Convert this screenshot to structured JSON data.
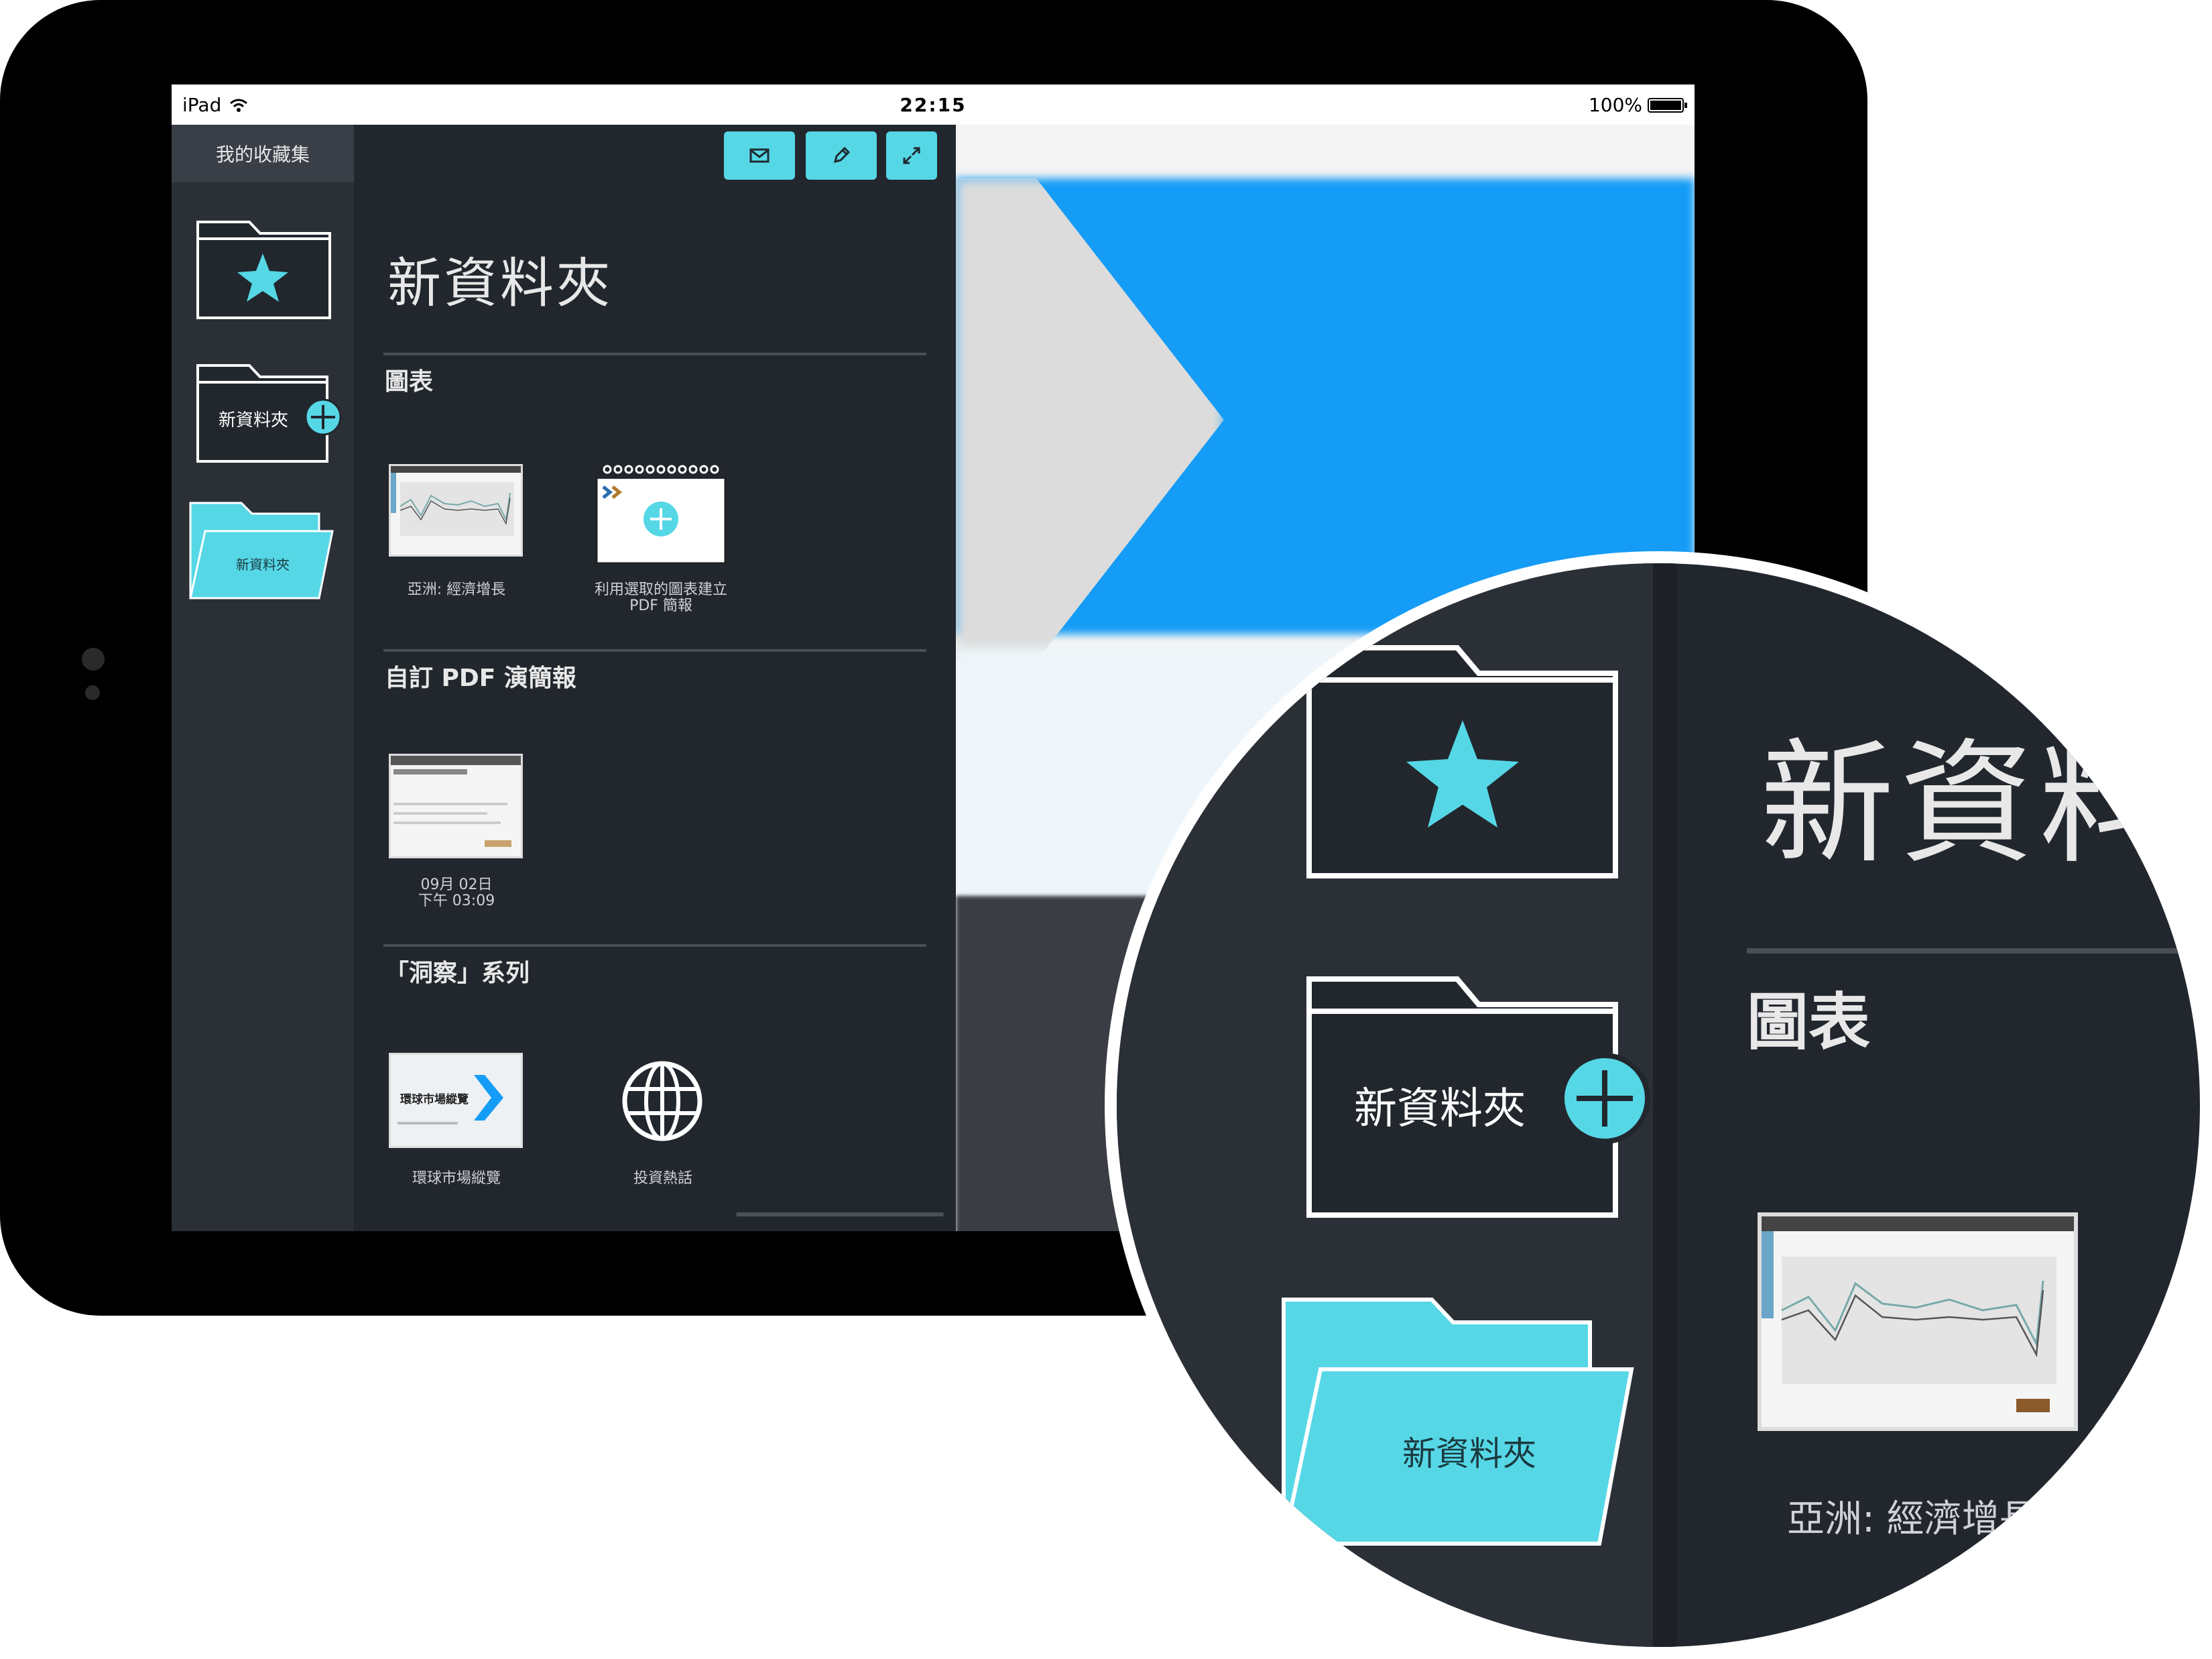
{
  "status_bar": {
    "device": "iPad",
    "time": "22:15",
    "battery": "100%"
  },
  "sidebar": {
    "header": "我的收藏集",
    "new_folder_label": "新資料夾",
    "active_folder_label": "新資料夾"
  },
  "toolbar": {
    "buttons": [
      "mail",
      "edit",
      "expand"
    ]
  },
  "panel": {
    "title": "新資料夾",
    "sections": [
      {
        "title": "圖表",
        "items": [
          {
            "caption": "亞洲: 經濟增長"
          },
          {
            "caption_line1": "利用選取的圖表建立",
            "caption_line2": "PDF 簡報"
          }
        ]
      },
      {
        "title": "自訂 PDF 演簡報",
        "items": [
          {
            "caption_line1": "09月 02日",
            "caption_line2": "下午 03:09"
          }
        ]
      },
      {
        "title": "「洞察」系列",
        "items": [
          {
            "caption": "環球市場縱覽",
            "thumb_text": "環球市場縱覽"
          },
          {
            "caption": "投資熱話"
          }
        ]
      }
    ]
  },
  "zoom": {
    "title": "新資料",
    "section": "圖表",
    "caption": "亞洲: 經濟增長",
    "new_folder_label": "新資料夾",
    "active_folder_label": "新資料夾"
  },
  "colors": {
    "accent": "#56d7e6",
    "panel": "#22272e",
    "rail": "#2b3037",
    "bezel": "#000000"
  },
  "icons": [
    "wifi-icon",
    "battery-icon",
    "star-icon",
    "plus-icon",
    "mail-icon",
    "pencil-icon",
    "expand-icon",
    "globe-icon"
  ]
}
